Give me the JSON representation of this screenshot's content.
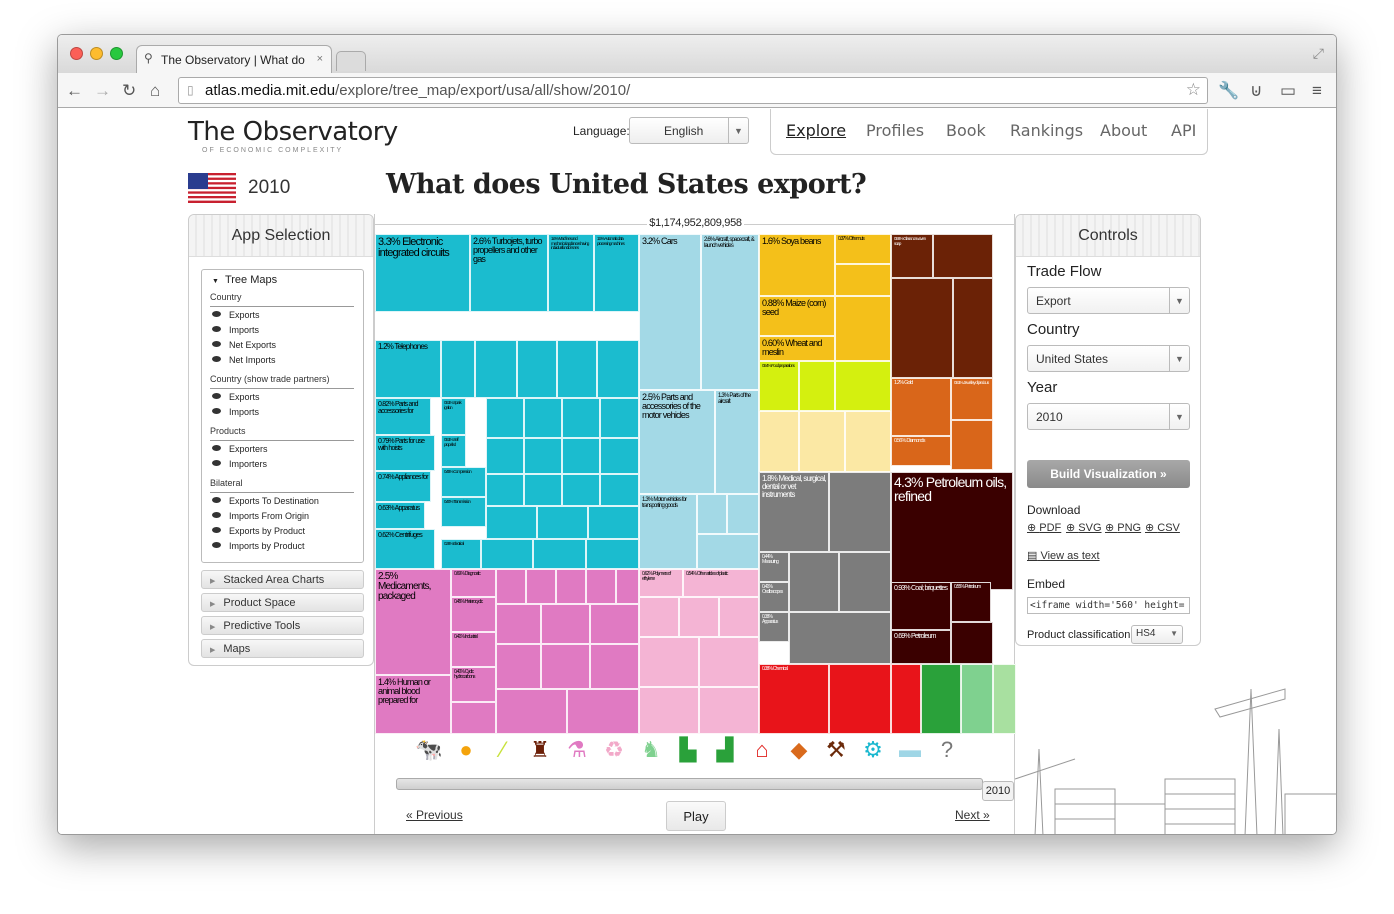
{
  "browser": {
    "tab_title": "The Observatory | What do",
    "tab_close": "×",
    "url_host": "atlas.media.mit.edu",
    "url_path": "/explore/tree_map/export/usa/all/show/2010/"
  },
  "header": {
    "logo_title": "The Observatory",
    "logo_subtitle": "OF ECONOMIC COMPLEXITY",
    "language_label": "Language:",
    "language_value": "English",
    "nav": [
      "Explore",
      "Profiles",
      "Book",
      "Rankings",
      "About",
      "API"
    ],
    "active_nav": "Explore"
  },
  "page": {
    "year": "2010",
    "headline": "What does United States export?"
  },
  "app_selection": {
    "title": "App Selection",
    "tree_maps_title": "Tree Maps",
    "sections": [
      {
        "title": "Country",
        "items": [
          "Exports",
          "Imports",
          "Net Exports",
          "Net Imports"
        ]
      },
      {
        "title": "Country (show trade partners)",
        "items": [
          "Exports",
          "Imports"
        ]
      },
      {
        "title": "Products",
        "items": [
          "Exporters",
          "Importers"
        ]
      },
      {
        "title": "Bilateral",
        "items": [
          "Exports To Destination",
          "Imports From Origin",
          "Exports by Product",
          "Imports by Product"
        ]
      }
    ],
    "accordion": [
      "Stacked Area Charts",
      "Product Space",
      "Predictive Tools",
      "Maps"
    ]
  },
  "controls": {
    "title": "Controls",
    "trade_flow_label": "Trade Flow",
    "trade_flow_value": "Export",
    "country_label": "Country",
    "country_value": "United States",
    "year_label": "Year",
    "year_value": "2010",
    "build_label": "Build Visualization »",
    "download_label": "Download",
    "downloads": [
      "PDF",
      "SVG",
      "PNG",
      "CSV"
    ],
    "view_as_text": "View as text",
    "embed_label": "Embed",
    "embed_value": "<iframe width='560' height=",
    "classification_label": "Product classification:",
    "classification_value": "HS4"
  },
  "viz": {
    "total": "$1,174,952,809,958",
    "year_tag": "2010",
    "prev_label": "« Previous",
    "next_label": "Next »",
    "play_label": "Play",
    "category_icons": [
      {
        "name": "cow-icon",
        "glyph": "🐄",
        "color": "#f7c98a"
      },
      {
        "name": "orange-icon",
        "glyph": "●",
        "color": "#f4a30c"
      },
      {
        "name": "leaf-icon",
        "glyph": "⁄",
        "color": "#c7e23a"
      },
      {
        "name": "oil-rig-icon",
        "glyph": "♜",
        "color": "#6b1f07"
      },
      {
        "name": "flask-icon",
        "glyph": "⚗",
        "color": "#e07ac2"
      },
      {
        "name": "recycle-icon",
        "glyph": "♻",
        "color": "#f2a9c9"
      },
      {
        "name": "deer-icon",
        "glyph": "♞",
        "color": "#7fd18f"
      },
      {
        "name": "sewing-machine-icon",
        "glyph": "▙",
        "color": "#2aa13a"
      },
      {
        "name": "shoe-icon",
        "glyph": "▟",
        "color": "#2aa13a"
      },
      {
        "name": "house-icon",
        "glyph": "⌂",
        "color": "#e0211e"
      },
      {
        "name": "gem-icon",
        "glyph": "◆",
        "color": "#d96a1c"
      },
      {
        "name": "pickaxe-icon",
        "glyph": "⚒",
        "color": "#6b2a0a"
      },
      {
        "name": "gears-icon",
        "glyph": "⚙",
        "color": "#1bb8cf"
      },
      {
        "name": "car-icon",
        "glyph": "▬",
        "color": "#9fd6e6"
      },
      {
        "name": "question-icon",
        "glyph": "?",
        "color": "#777777"
      }
    ]
  },
  "chart_data": {
    "type": "treemap",
    "title": "What does United States export?",
    "total": "$1,174,952,809,958",
    "tiles": [
      {
        "label": "3.3% Electronic integrated circuits",
        "share": 3.3,
        "color": "#1bbccf"
      },
      {
        "label": "2.6% Turbojets, turbo propellers and other gas",
        "share": 2.6,
        "color": "#1bbccf"
      },
      {
        "label": "1.6% Machines and mechanical appliances having individual functions nes",
        "share": 1.6,
        "color": "#1bbccf"
      },
      {
        "label": "1.5% Automatic data processing machines",
        "share": 1.5,
        "color": "#1bbccf"
      },
      {
        "label": "1.2% Telephones",
        "share": 1.2,
        "color": "#1bbccf"
      },
      {
        "label": "0.82% Parts and accessories for",
        "share": 0.82,
        "color": "#1bbccf"
      },
      {
        "label": "0.79% Parts for use with hoists",
        "share": 0.79,
        "color": "#1bbccf"
      },
      {
        "label": "0.74% Appliances for",
        "share": 0.74,
        "color": "#1bbccf"
      },
      {
        "label": "0.63% Apparatus",
        "share": 0.63,
        "color": "#1bbccf"
      },
      {
        "label": "0.62% Centrifuges",
        "share": 0.62,
        "color": "#1bbccf"
      },
      {
        "label": "0.51% Spark ignition",
        "share": 0.51,
        "color": "#1bbccf"
      },
      {
        "label": "0.51% Self propelled",
        "share": 0.51,
        "color": "#1bbccf"
      },
      {
        "label": "0.45% Compression",
        "share": 0.45,
        "color": "#1bbccf"
      },
      {
        "label": "0.40% Transmission",
        "share": 0.4,
        "color": "#1bbccf"
      },
      {
        "label": "0.36% Electrical",
        "share": 0.36,
        "color": "#1bbccf"
      },
      {
        "label": "3.2% Cars",
        "share": 3.2,
        "color": "#a3d9e6"
      },
      {
        "label": "2.6% Aircraft, spacecraft, & launch vehicles",
        "share": 2.6,
        "color": "#a3d9e6"
      },
      {
        "label": "2.5% Parts and accessories of the motor vehicles",
        "share": 2.5,
        "color": "#a3d9e6"
      },
      {
        "label": "1.3% Motor vehicles for transporting goods",
        "share": 1.3,
        "color": "#a3d9e6"
      },
      {
        "label": "1.3% Parts of the aircraft",
        "share": 1.3,
        "color": "#a3d9e6"
      },
      {
        "label": "2.5% Medicaments, packaged",
        "share": 2.5,
        "color": "#e07ac2"
      },
      {
        "label": "1.4% Human or animal blood prepared for",
        "share": 1.4,
        "color": "#e07ac2"
      },
      {
        "label": "0.69% Diagnostic",
        "share": 0.69,
        "color": "#e07ac2"
      },
      {
        "label": "0.45% Heterocyclic",
        "share": 0.45,
        "color": "#e07ac2"
      },
      {
        "label": "0.41% Industrial",
        "share": 0.41,
        "color": "#e07ac2"
      },
      {
        "label": "0.40% Cyclic hydrocarbons",
        "share": 0.4,
        "color": "#e07ac2"
      },
      {
        "label": "0.62% Polymers of ethylene",
        "share": 0.62,
        "color": "#f4b4d4"
      },
      {
        "label": "0.54% Other articles of plastic",
        "share": 0.54,
        "color": "#f4b4d4"
      },
      {
        "label": "1.6% Soya beans",
        "share": 1.6,
        "color": "#f4c01a"
      },
      {
        "label": "0.88% Maize (corn) seed",
        "share": 0.88,
        "color": "#f4c01a"
      },
      {
        "label": "0.60% Wheat and meslin",
        "share": 0.6,
        "color": "#f4c01a"
      },
      {
        "label": "0.54% Food preparations",
        "share": 0.54,
        "color": "#d4f00f"
      },
      {
        "label": "0.37% Other nuts",
        "share": 0.37,
        "color": "#f4c01a"
      },
      {
        "label": "0.56% Glass nonwoven soap",
        "share": 0.56,
        "color": "#6b2206"
      },
      {
        "label": "1.2% Gold",
        "share": 1.2,
        "color": "#d9661a"
      },
      {
        "label": "0.56% Diamonds",
        "share": 0.56,
        "color": "#d9661a"
      },
      {
        "label": "0.51% Jewellery of precious",
        "share": 0.51,
        "color": "#d9661a"
      },
      {
        "label": "1.8% Medical, surgical, dental or vet instruments",
        "share": 1.8,
        "color": "#7c7c7c"
      },
      {
        "label": "0.44% Measuring",
        "share": 0.44,
        "color": "#7c7c7c"
      },
      {
        "label": "0.41% Oscilloscopes",
        "share": 0.41,
        "color": "#7c7c7c"
      },
      {
        "label": "0.38% Apparatus",
        "share": 0.38,
        "color": "#7c7c7c"
      },
      {
        "label": "4.3% Petroleum oils, refined",
        "share": 4.3,
        "color": "#3a0000"
      },
      {
        "label": "0.93% Coal; briquettes",
        "share": 0.93,
        "color": "#3a0000"
      },
      {
        "label": "0.69% Petroleum",
        "share": 0.69,
        "color": "#3a0000"
      },
      {
        "label": "0.55% Petroleum",
        "share": 0.55,
        "color": "#3a0000"
      },
      {
        "label": "0.38% Chemical",
        "share": 0.38,
        "color": "#e8141a"
      }
    ]
  }
}
